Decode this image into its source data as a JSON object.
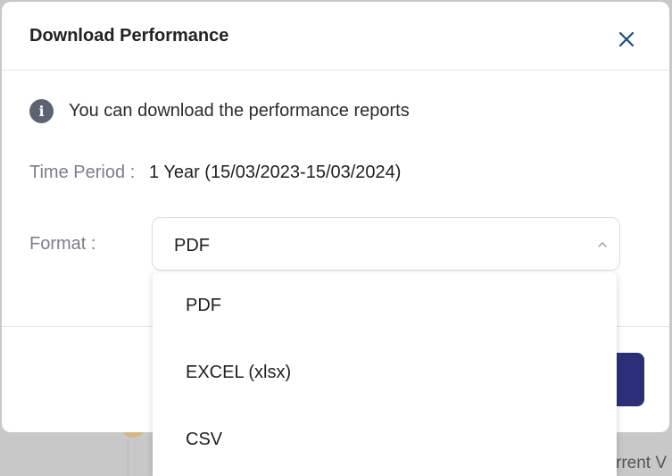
{
  "modal": {
    "title": "Download Performance",
    "info_text": "You can download the performance reports",
    "time_period_label": "Time Period :",
    "time_period_value": "1 Year (15/03/2023-15/03/2024)",
    "format_label": "Format :",
    "format_selected": "PDF"
  },
  "dropdown": {
    "options": [
      {
        "label": "PDF"
      },
      {
        "label": "EXCEL (xlsx)"
      },
      {
        "label": "CSV"
      }
    ]
  },
  "background": {
    "partial_text": "rrent V"
  },
  "colors": {
    "primary": "#2b2f78",
    "close_icon": "#1d4f7a",
    "info_icon": "#5f6371",
    "muted_label": "#7a7f87"
  },
  "icons": {
    "close": "close-icon",
    "info": "info-icon",
    "chevron": "chevron-up-icon"
  }
}
